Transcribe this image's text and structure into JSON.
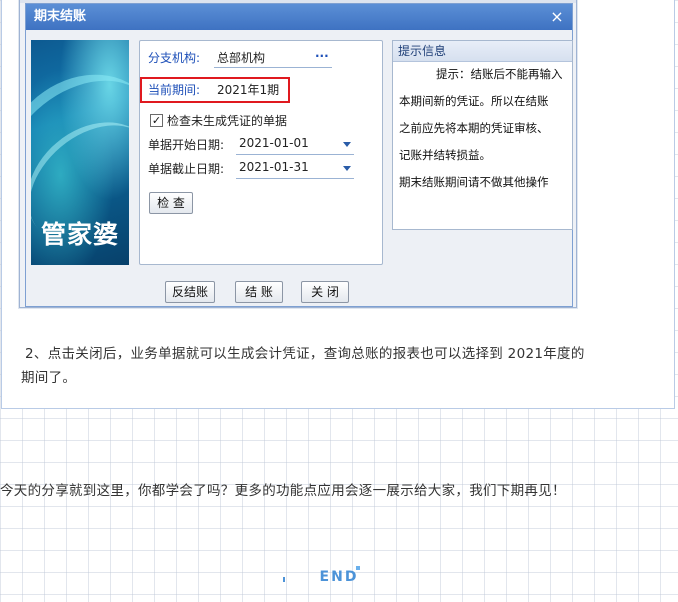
{
  "dialog": {
    "title": "期末结账",
    "close_glyph": "×",
    "logo_text": "管家婆",
    "branch_label": "分支机构:",
    "branch_value": "总部机构",
    "branch_more": "···",
    "period_label": "当前期间:",
    "period_value": "2021年1期",
    "check_unvouchered_label": "检查未生成凭证的单据",
    "check_unvouchered_checked": true,
    "start_date_label": "单据开始日期:",
    "start_date_value": "2021-01-01",
    "end_date_label": "单据截止日期:",
    "end_date_value": "2021-01-31",
    "check_button": "检 查",
    "info_title": "提示信息",
    "info_lines": [
      "提示：结账后不能再输入",
      "本期间新的凭证。所以在结账",
      "之前应先将本期的凭证审核、",
      "记账并结转损益。",
      "期末结账期间请不做其他操作"
    ],
    "unclose_button": "反结账",
    "close_account_button": "结 账",
    "close_button": "关 闭"
  },
  "article": {
    "paragraph_1": "2、点击关闭后，业务单据就可以生成会计凭证，查询总账的报表也可以选择到 2021年度的",
    "paragraph_1_cont": "期间了。",
    "paragraph_2": "今天的分享就到这里，你都学会了吗？更多的功能点应用会逐一展示给大家，我们下期再见！",
    "end_mark": "END"
  },
  "colors": {
    "highlight": "#e0191f",
    "title_bar": "#3e72c2",
    "accent_blue": "#4c93d8"
  }
}
